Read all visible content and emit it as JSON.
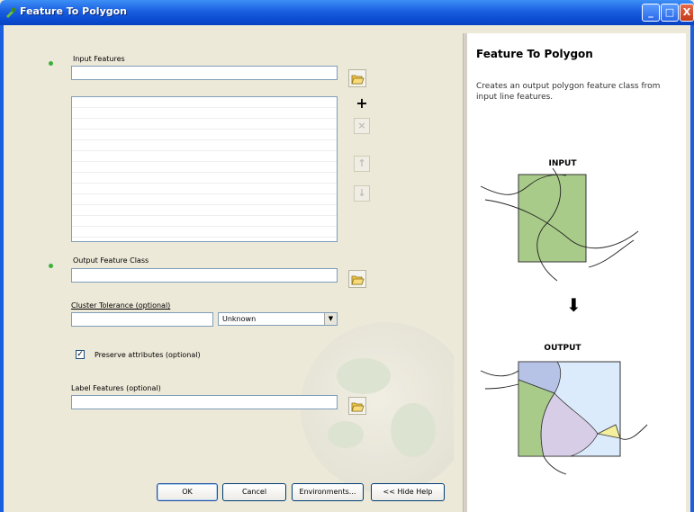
{
  "window": {
    "title": "Feature To Polygon",
    "controls": {
      "minimize": "_",
      "maximize": "□",
      "close": "X"
    }
  },
  "form": {
    "input_features": {
      "label": "Input Features",
      "value": "",
      "required": true
    },
    "list_buttons": {
      "add": "+",
      "remove": "×",
      "up": "↑",
      "down": "↓"
    },
    "output_feature_class": {
      "label": "Output Feature Class",
      "value": "",
      "required": true
    },
    "cluster_tolerance": {
      "label": "Cluster Tolerance (optional)",
      "value": "",
      "unit": "Unknown"
    },
    "preserve_attributes": {
      "label": "Preserve attributes (optional)",
      "checked": true,
      "check_glyph": "✓"
    },
    "label_features": {
      "label": "Label Features (optional)",
      "value": ""
    }
  },
  "buttons": {
    "ok": "OK",
    "cancel": "Cancel",
    "environments": "Environments...",
    "hide_help": "<< Hide Help"
  },
  "help": {
    "title": "Feature To Polygon",
    "description": "Creates an output polygon feature class from input line features.",
    "input_caption": "INPUT",
    "output_caption": "OUTPUT",
    "arrow": "⬇"
  },
  "colors": {
    "polygon_green": "#a9cb8a",
    "polygon_blue": "#b7c3e6",
    "polygon_lavender": "#d7cde6",
    "polygon_yellow": "#f4ef9c",
    "polygon_lightblue": "#dcebfb",
    "titlebar_blue": "#0a4bd0"
  }
}
